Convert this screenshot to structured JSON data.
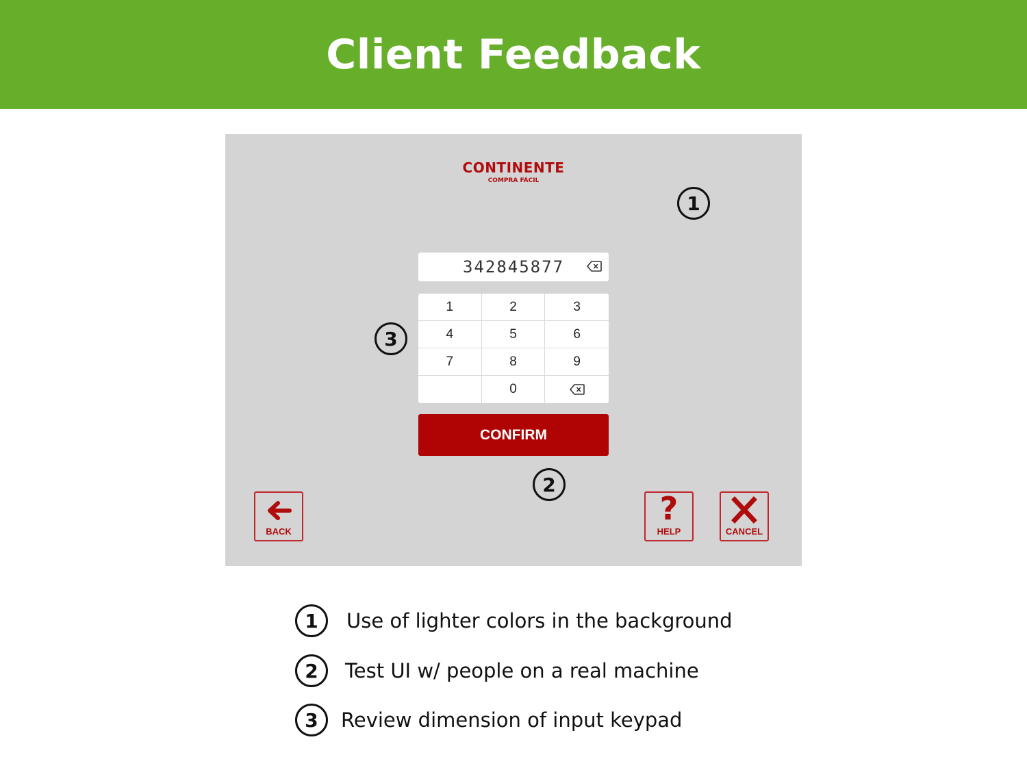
{
  "slide": {
    "title": "Client Feedback"
  },
  "kiosk": {
    "brand": {
      "name": "CONTINENTE",
      "tagline": "COMPRA FÁCIL"
    },
    "pin_value": "342845877",
    "keypad": {
      "keys": [
        {
          "label": "1"
        },
        {
          "label": "2"
        },
        {
          "label": "3"
        },
        {
          "label": "4"
        },
        {
          "label": "5"
        },
        {
          "label": "6"
        },
        {
          "label": "7"
        },
        {
          "label": "8"
        },
        {
          "label": "9"
        },
        {
          "label": ""
        },
        {
          "label": "0"
        },
        {
          "label": "",
          "icon": "backspace-icon"
        }
      ]
    },
    "confirm_label": "CONFIRM",
    "back_label": "BACK",
    "help_label": "HELP",
    "help_symbol": "?",
    "cancel_label": "CANCEL"
  },
  "markers": {
    "m1": "1",
    "m2": "2",
    "m3": "3"
  },
  "feedback": [
    {
      "number": "1",
      "text": "Use of lighter colors in the background"
    },
    {
      "number": "2",
      "text": "Test UI w/ people on a real machine"
    },
    {
      "number": "3",
      "text": "Review dimension of input keypad"
    }
  ],
  "colors": {
    "header_green": "#67ae2b",
    "brand_red": "#b00404",
    "kiosk_background": "#d4d4d4"
  },
  "icons": [
    "backspace-icon",
    "arrow-left-icon",
    "question-icon",
    "close-icon"
  ]
}
